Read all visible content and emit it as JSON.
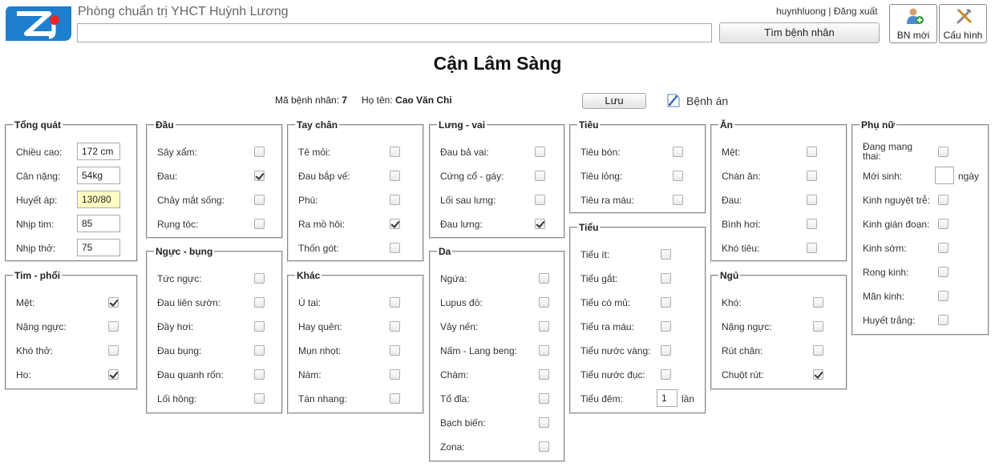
{
  "header": {
    "clinic_name": "Phòng chuẩn trị YHCT Huỳnh Lương",
    "search_value": "",
    "user": "huynhluong",
    "separator": " | ",
    "logout": "Đăng xuất",
    "find_patient": "Tìm bệnh nhân",
    "new_patient": "BN mới",
    "settings": "Cấu hình"
  },
  "page": {
    "title": "Cận Lâm Sàng",
    "patient_id_label": "Mã bệnh nhân:",
    "patient_id": "7",
    "patient_name_label": "Họ tên:",
    "patient_name": "Cao Văn Chi",
    "save": "Lưu",
    "medical_record": "Bệnh án"
  },
  "groups": {
    "general": {
      "title": "Tổng quát",
      "fields": [
        {
          "label": "Chiều cao:",
          "value": "172 cm"
        },
        {
          "label": "Cân nặng:",
          "value": "54kg"
        },
        {
          "label": "Huyết áp:",
          "value": "130/80"
        },
        {
          "label": "Nhịp tim:",
          "value": "85"
        },
        {
          "label": "Nhịp thở:",
          "value": "75"
        }
      ]
    },
    "heart_lung": {
      "title": "Tim - phổi",
      "items": [
        {
          "label": "Mệt:",
          "checked": true
        },
        {
          "label": "Nặng ngực:",
          "checked": false
        },
        {
          "label": "Khó thở:",
          "checked": false
        },
        {
          "label": "Ho:",
          "checked": true
        }
      ]
    },
    "head": {
      "title": "Đầu",
      "items": [
        {
          "label": "Sây xẩm:",
          "checked": false
        },
        {
          "label": "Đau:",
          "checked": true
        },
        {
          "label": "Chảy mắt sống:",
          "checked": false
        },
        {
          "label": "Rụng tóc:",
          "checked": false
        }
      ]
    },
    "chest_abdomen": {
      "title": "Ngực - bụng",
      "items": [
        {
          "label": "Tức ngực:",
          "checked": false
        },
        {
          "label": "Đau liên sườn:",
          "checked": false
        },
        {
          "label": "Đầy hơi:",
          "checked": false
        },
        {
          "label": "Đau bụng:",
          "checked": false
        },
        {
          "label": "Đau quanh rốn:",
          "checked": false
        },
        {
          "label": "Lối hông:",
          "checked": false
        }
      ]
    },
    "limbs": {
      "title": "Tay chân",
      "items": [
        {
          "label": "Tê mỏi:",
          "checked": false
        },
        {
          "label": "Đau bắp vế:",
          "checked": false
        },
        {
          "label": "Phù:",
          "checked": false
        },
        {
          "label": "Ra mồ hôi:",
          "checked": true
        },
        {
          "label": "Thốn gót:",
          "checked": false
        }
      ]
    },
    "other": {
      "title": "Khác",
      "items": [
        {
          "label": "Ù tai:",
          "checked": false
        },
        {
          "label": "Hay quên:",
          "checked": false
        },
        {
          "label": "Mụn nhọt:",
          "checked": false
        },
        {
          "label": "Nám:",
          "checked": false
        },
        {
          "label": "Tàn nhang:",
          "checked": false
        }
      ]
    },
    "back_shoulder": {
      "title": "Lưng - vai",
      "items": [
        {
          "label": "Đau bả vai:",
          "checked": false
        },
        {
          "label": "Cứng cổ - gáy:",
          "checked": false
        },
        {
          "label": "Lối sau lưng:",
          "checked": false
        },
        {
          "label": "Đau lưng:",
          "checked": true
        }
      ]
    },
    "skin": {
      "title": "Da",
      "items": [
        {
          "label": "Ngứa:",
          "checked": false
        },
        {
          "label": "Lupus đỏ:",
          "checked": false
        },
        {
          "label": "Vảy nến:",
          "checked": false
        },
        {
          "label": "Nấm - Lang beng:",
          "checked": false
        },
        {
          "label": "Chàm:",
          "checked": false
        },
        {
          "label": "Tổ đỉa:",
          "checked": false
        },
        {
          "label": "Bạch biến:",
          "checked": false
        },
        {
          "label": "Zona:",
          "checked": false
        }
      ]
    },
    "stool": {
      "title": "Tiêu",
      "items": [
        {
          "label": "Tiêu bón:",
          "checked": false
        },
        {
          "label": "Tiêu lỏng:",
          "checked": false
        },
        {
          "label": "Tiêu ra máu:",
          "checked": false
        }
      ]
    },
    "urine": {
      "title": "Tiểu",
      "items": [
        {
          "label": "Tiểu ít:",
          "checked": false
        },
        {
          "label": "Tiểu gắt:",
          "checked": false
        },
        {
          "label": "Tiểu có mủ:",
          "checked": false
        },
        {
          "label": "Tiểu ra máu:",
          "checked": false
        },
        {
          "label": "Tiểu nước vàng:",
          "checked": false
        },
        {
          "label": "Tiểu nước đục:",
          "checked": false
        }
      ],
      "night": {
        "label": "Tiểu đêm:",
        "value": "1",
        "unit": "lần"
      }
    },
    "eating": {
      "title": "Ăn",
      "items": [
        {
          "label": "Mệt:",
          "checked": false
        },
        {
          "label": "Chán ăn:",
          "checked": false
        },
        {
          "label": "Đau:",
          "checked": false
        },
        {
          "label": "Bình hơi:",
          "checked": false
        },
        {
          "label": "Khó tiêu:",
          "checked": false
        }
      ]
    },
    "sleep": {
      "title": "Ngủ",
      "items": [
        {
          "label": "Khó:",
          "checked": false
        },
        {
          "label": "Nặng ngực:",
          "checked": false
        },
        {
          "label": "Rút chân:",
          "checked": false
        },
        {
          "label": "Chuột rút:",
          "checked": true
        }
      ]
    },
    "women": {
      "title": "Phụ nữ",
      "items": [
        {
          "label": "Đang mang",
          "label2": "thai:",
          "checked": false
        },
        {
          "label": "Mới sinh:",
          "input": "",
          "unit": "ngày"
        },
        {
          "label": "Kinh nguyệt trễ:",
          "checked": false
        },
        {
          "label": "Kinh gián đoạn:",
          "checked": false
        },
        {
          "label": "Kinh sớm:",
          "checked": false
        },
        {
          "label": "Rong kinh:",
          "checked": false
        },
        {
          "label": "Mãn kinh:",
          "checked": false
        },
        {
          "label": "Huyết trắng:",
          "checked": false
        }
      ]
    }
  }
}
